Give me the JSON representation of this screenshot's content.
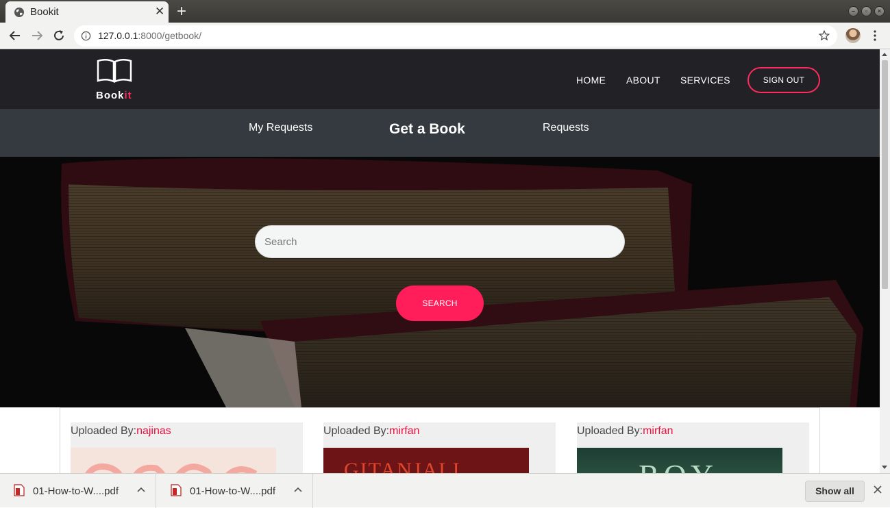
{
  "browser": {
    "tab_title": "Bookit",
    "new_tab": "+",
    "url_host": "127.0.0.1",
    "url_rest": ":8000/getbook/"
  },
  "header": {
    "logo_main": "Book",
    "logo_accent": "it",
    "nav": [
      "HOME",
      "ABOUT",
      "SERVICES"
    ],
    "signout_label": "SIGN OUT",
    "accent_color": "#ff2a5e"
  },
  "subnav": {
    "left": "My Requests",
    "active": "Get a Book",
    "right": "Requests"
  },
  "search": {
    "placeholder": "Search",
    "button_label": "SEARCH"
  },
  "cards": [
    {
      "uploaded_by_label": "Uploaded By:",
      "user": "najinas",
      "cover": "malayalam-title-cover"
    },
    {
      "uploaded_by_label": "Uploaded By:",
      "user": "mirfan",
      "cover": "gitanjali-cover",
      "cover_text": "GITANJALI"
    },
    {
      "uploaded_by_label": "Uploaded By:",
      "user": "mirfan",
      "cover": "roy-cover",
      "cover_text": "ROY"
    }
  ],
  "downloads": {
    "items": [
      "01-How-to-W....pdf",
      "01-How-to-W....pdf"
    ],
    "show_all": "Show all"
  }
}
